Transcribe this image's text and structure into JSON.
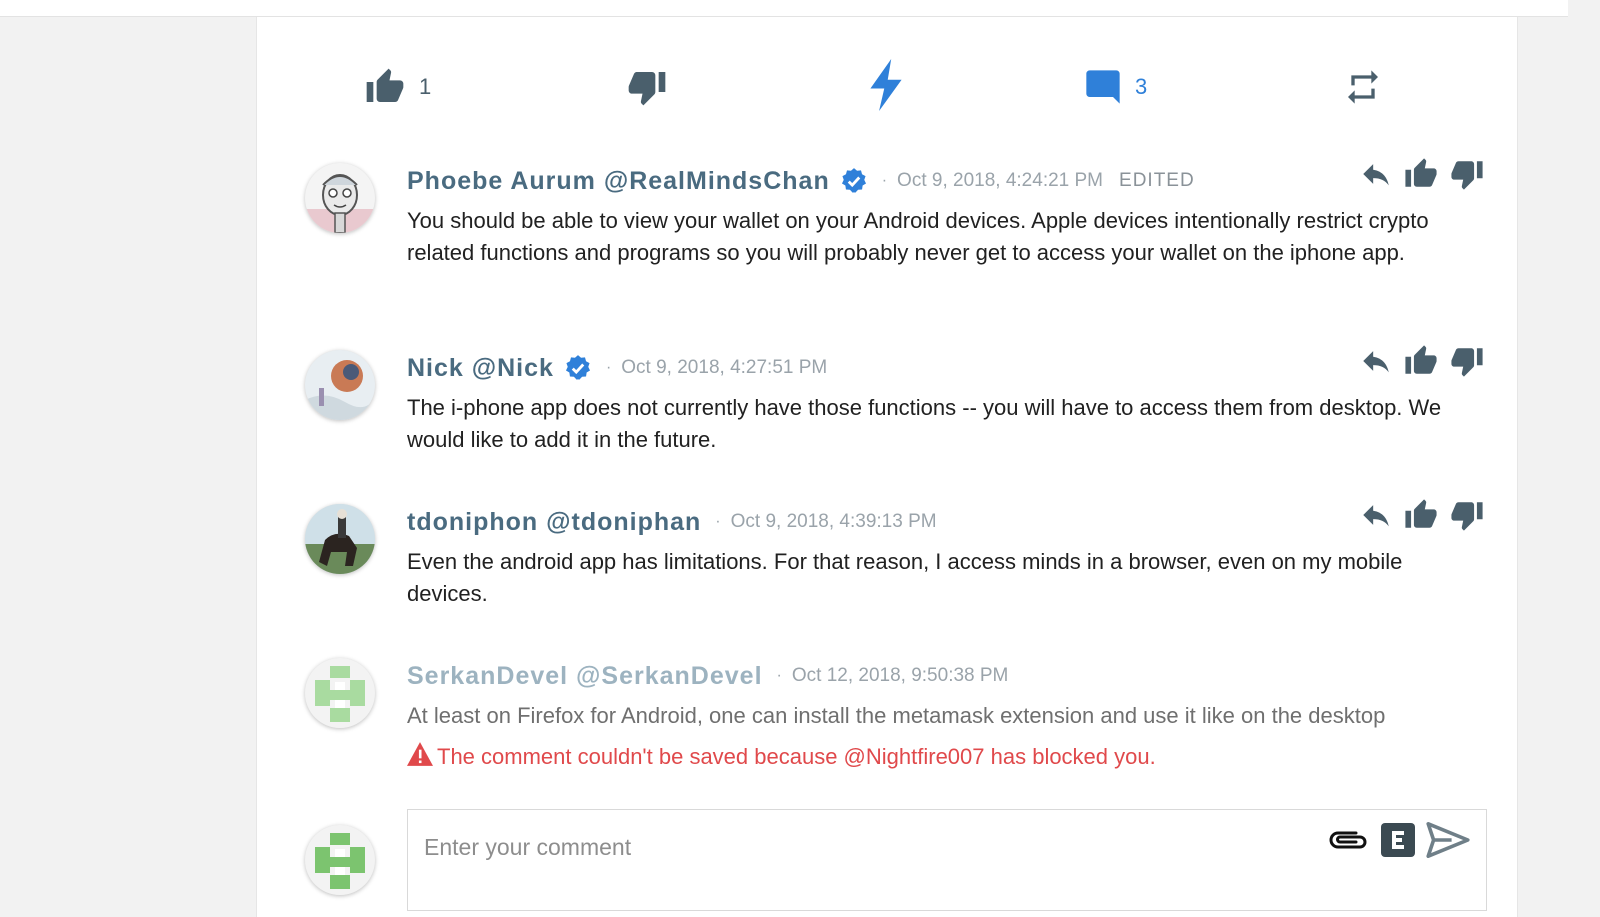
{
  "actions": {
    "upvote_count": "1",
    "comment_count": "3"
  },
  "comments": [
    {
      "author": "Phoebe Aurum @RealMindsChan",
      "verified": true,
      "timestamp": "Oct 9, 2018, 4:24:21 PM",
      "edited_label": "EDITED",
      "text": "You should be able to view your wallet on your Android devices. Apple devices intentionally restrict crypto related functions and programs so you will probably never get to access your wallet on the iphone app."
    },
    {
      "author": "Nick @Nick",
      "verified": true,
      "timestamp": "Oct 9, 2018, 4:27:51 PM",
      "text": "The i-phone app does not currently have those functions -- you will have to access them from desktop. We would like to add it in the future."
    },
    {
      "author": "tdoniphon @tdoniphan",
      "verified": false,
      "timestamp": "Oct 9, 2018, 4:39:13 PM",
      "text": "Even the android app has limitations. For that reason, I access minds in a browser, even on my mobile devices."
    },
    {
      "author": "SerkanDevel @SerkanDevel",
      "verified": false,
      "timestamp": "Oct 12, 2018, 9:50:38 PM",
      "text": "At least on Firefox for Android, one can install the metamask extension and use it like on the desktop",
      "error": "The comment couldn't be saved because @Nightfire007 has blocked you."
    }
  ],
  "composer": {
    "placeholder": "Enter your comment",
    "value": ""
  },
  "colors": {
    "accent": "#2f80d9",
    "icon": "#4a5f6c",
    "username": "#4a6b80",
    "error": "#e0494b"
  },
  "icons": [
    "thumb-up-icon",
    "thumb-down-icon",
    "bolt-icon",
    "comment-icon",
    "repeat-icon",
    "reply-icon",
    "verified-icon",
    "warning-icon",
    "attachment-icon",
    "editor-icon",
    "send-icon"
  ]
}
